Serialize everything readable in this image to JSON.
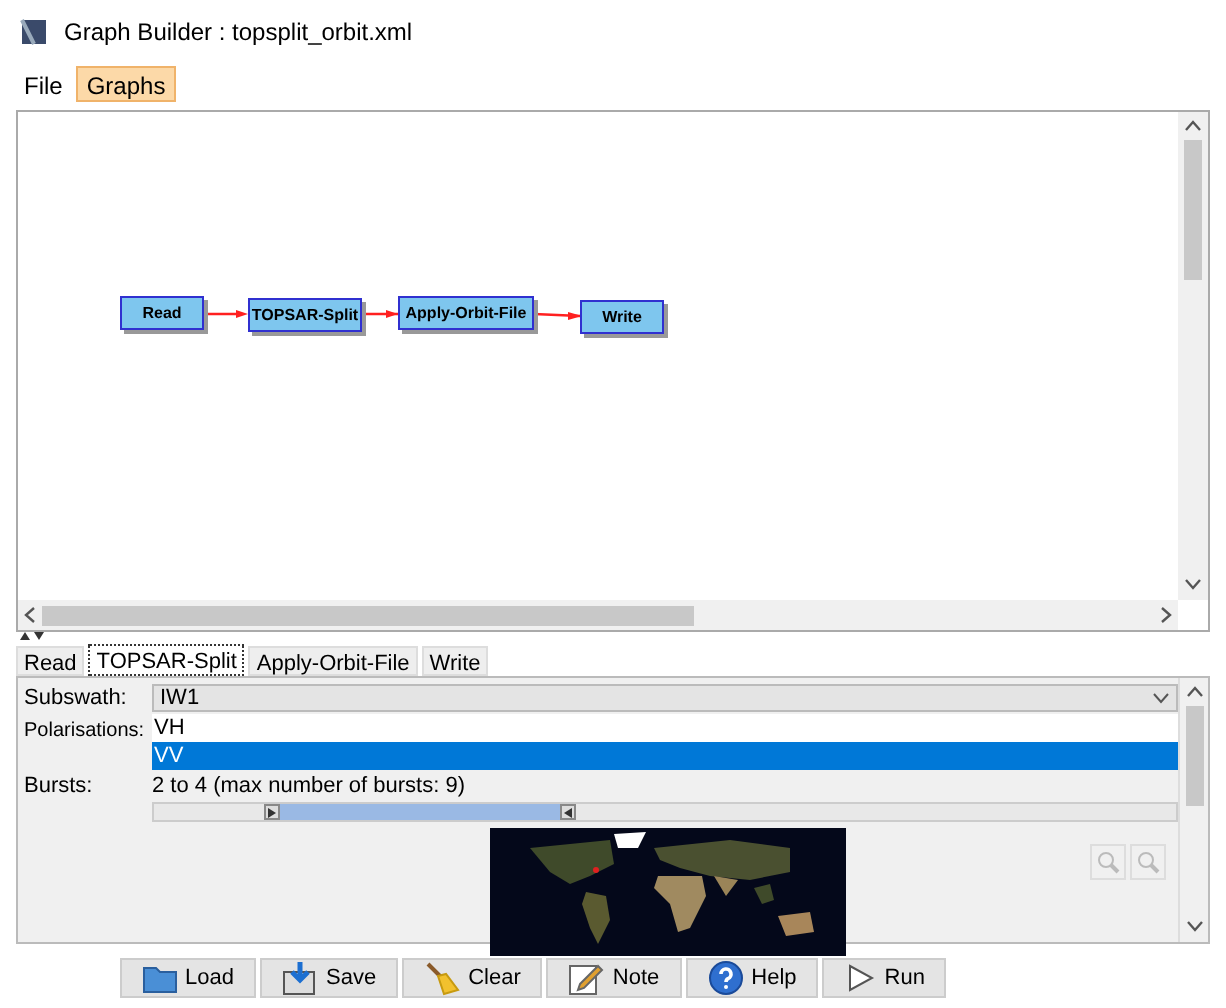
{
  "window": {
    "title": "Graph Builder : topsplit_orbit.xml"
  },
  "menu": [
    {
      "label": "File",
      "selected": false
    },
    {
      "label": "Graphs",
      "selected": true
    }
  ],
  "graph": {
    "nodes": [
      {
        "label": "Read"
      },
      {
        "label": "TOPSAR-Split"
      },
      {
        "label": "Apply-Orbit-File"
      },
      {
        "label": "Write"
      }
    ]
  },
  "tabs": [
    {
      "label": "Read",
      "selected": false
    },
    {
      "label": "TOPSAR-Split",
      "selected": true
    },
    {
      "label": "Apply-Orbit-File",
      "selected": false
    },
    {
      "label": "Write",
      "selected": false
    }
  ],
  "form": {
    "subswath": {
      "label": "Subswath:",
      "value": "IW1"
    },
    "polarisations": {
      "label": "Polarisations:",
      "items": [
        {
          "label": "VH",
          "selected": false
        },
        {
          "label": "VV",
          "selected": true
        }
      ]
    },
    "bursts": {
      "label": "Bursts:",
      "reading": "2 to 4 (max number of bursts: 9)",
      "thumbs": [
        {
          "level": 0.124
        },
        {
          "level": 0.398
        }
      ]
    }
  },
  "buttons": [
    {
      "label": "Load",
      "kind": "load"
    },
    {
      "label": "Save",
      "kind": "save"
    },
    {
      "label": "Clear",
      "kind": "clear"
    },
    {
      "label": "Note",
      "kind": "note"
    },
    {
      "label": "Help",
      "kind": "help"
    },
    {
      "label": "Run",
      "kind": "run"
    }
  ]
}
